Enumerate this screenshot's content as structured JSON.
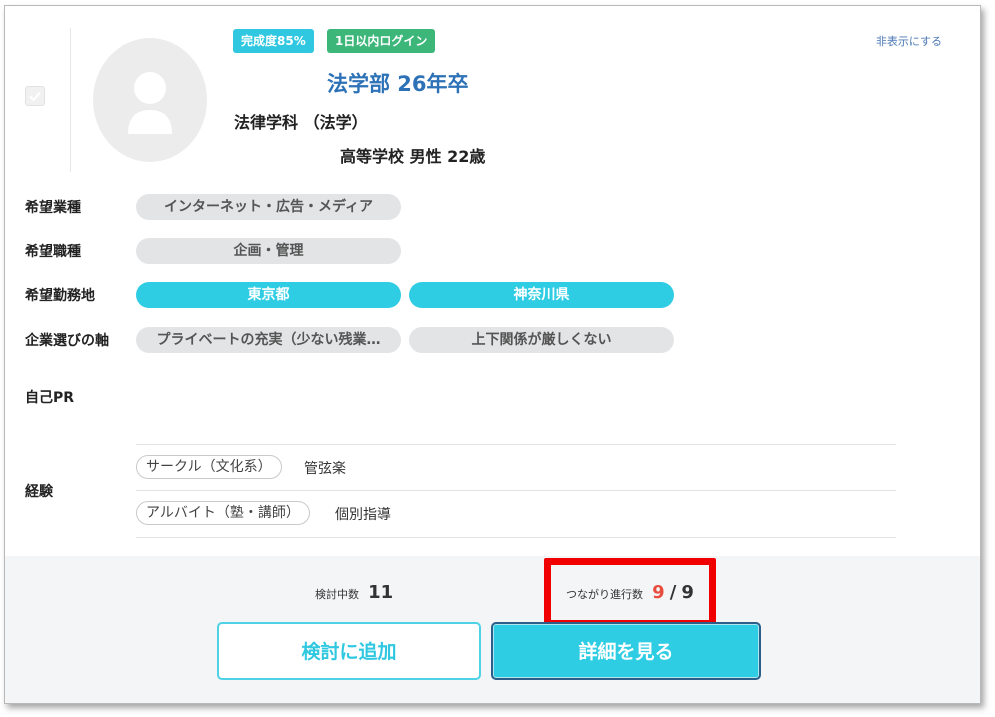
{
  "badges": {
    "completion": "完成度85%",
    "login": "1日以内ログイン"
  },
  "hide_link": "非表示にする",
  "profile": {
    "university": "法学部 26年卒",
    "department": "法律学科 （法学）",
    "school_gender_age": "高等学校 男性 22歳"
  },
  "rows": {
    "industry": {
      "label": "希望業種",
      "values": [
        "インターネット・広告・メディア"
      ]
    },
    "job": {
      "label": "希望職種",
      "values": [
        "企画・管理"
      ]
    },
    "location": {
      "label": "希望勤務地",
      "values": [
        "東京都",
        "神奈川県"
      ]
    },
    "axis": {
      "label": "企業選びの軸",
      "values": [
        "プライベートの充実（少ない残業…",
        "上下関係が厳しくない"
      ]
    },
    "pr": {
      "label": "自己PR"
    },
    "experience": {
      "label": "経験",
      "items": [
        {
          "tag": "サークル（文化系）",
          "detail": "管弦楽"
        },
        {
          "tag": "アルバイト（塾・講師）",
          "detail": "個別指導"
        }
      ]
    }
  },
  "footer": {
    "reviewing_label": "検討中数",
    "reviewing_count": "11",
    "connections_label": "つながり進行数",
    "connections_current": "9",
    "connections_separator": "/",
    "connections_total": "9",
    "add_button": "検討に追加",
    "detail_button": "詳細を見る"
  },
  "colors": {
    "accent": "#2fcde3",
    "login_badge": "#3db67a",
    "university_text": "#2d72b7",
    "highlight_box": "#f00000",
    "connections_current": "#e74c3c"
  }
}
